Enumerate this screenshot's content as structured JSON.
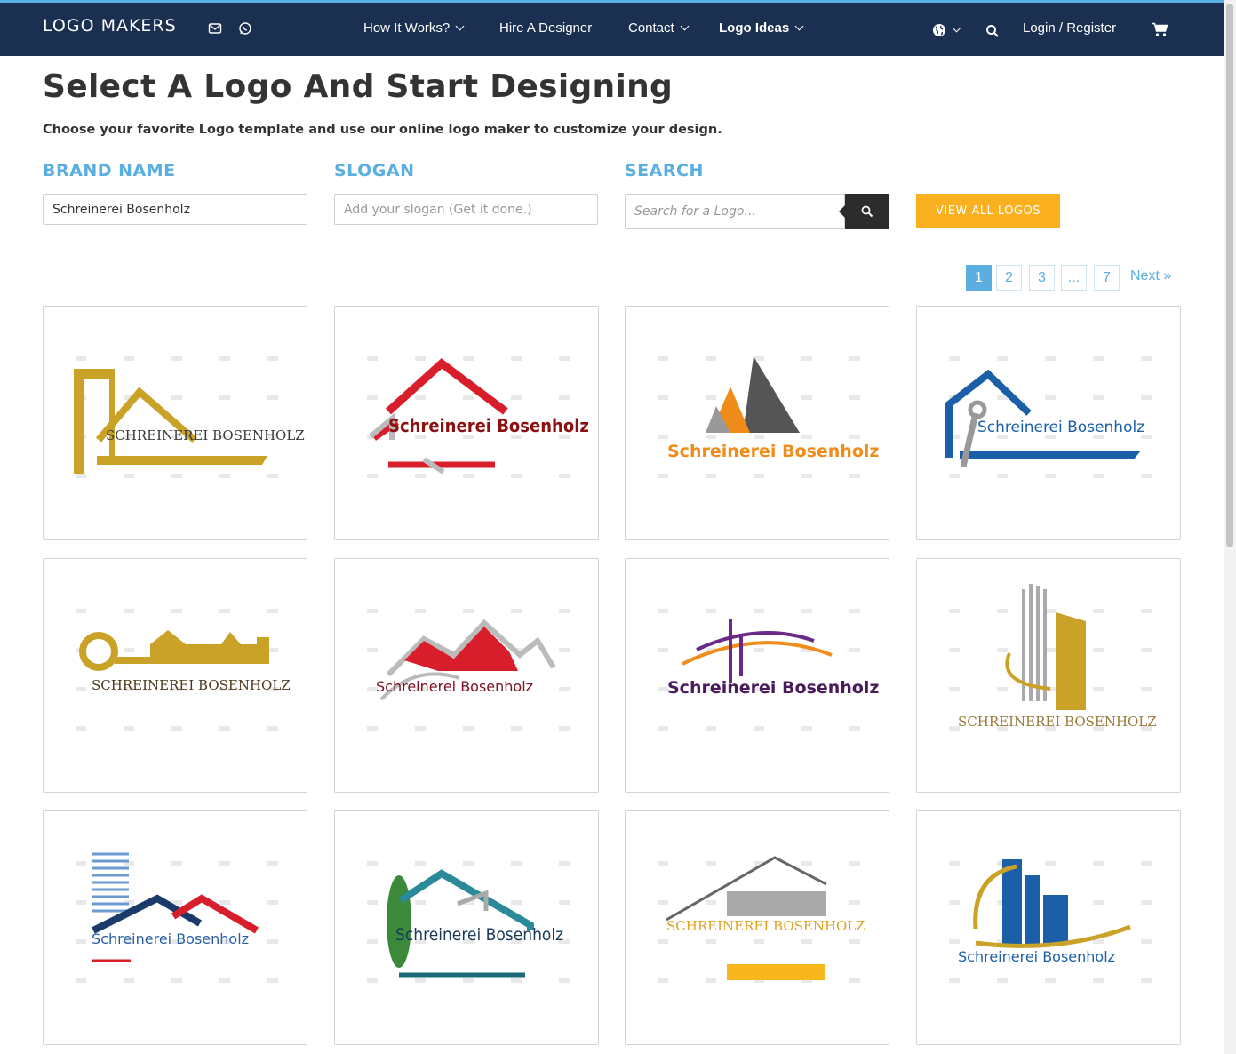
{
  "header": {
    "logo": "LOGO MAKERS",
    "nav": [
      {
        "label": "How It Works?",
        "dropdown": true
      },
      {
        "label": "Hire A Designer",
        "dropdown": false
      },
      {
        "label": "Contact",
        "dropdown": true
      },
      {
        "label": "Logo Ideas",
        "dropdown": true
      }
    ],
    "login": "Login / Register",
    "icons": [
      "mail-icon",
      "whatsapp-icon",
      "globe-icon",
      "search-icon",
      "cart-icon"
    ]
  },
  "page": {
    "title": "Select A Logo And Start Designing",
    "subtitle": "Choose your favorite Logo template and use our online logo maker to customize your design."
  },
  "form": {
    "brand_label": "BRAND NAME",
    "brand_value": "Schreinerei Bosenholz",
    "slogan_label": "SLOGAN",
    "slogan_placeholder": "Add your slogan (Get it done.)",
    "search_label": "SEARCH",
    "search_placeholder": "Search for a Logo...",
    "view_all": "VIEW ALL LOGOS"
  },
  "pagination": {
    "pages": [
      "1",
      "2",
      "3",
      "...",
      "7"
    ],
    "active": "1",
    "next": "Next »"
  },
  "logos": [
    {
      "text": "SCHREINEREI BOSENHOLZ",
      "color": "#3a3a3a"
    },
    {
      "text": "Schreinerei Bosenholz",
      "color": "#8c1010"
    },
    {
      "text": "Schreinerei Bosenholz",
      "color": "#f08c1a"
    },
    {
      "text": "Schreinerei Bosenholz",
      "color": "#1a5fa8"
    },
    {
      "text": "SCHREINEREI BOSENHOLZ",
      "color": "#4a3a1a"
    },
    {
      "text": "Schreinerei Bosenholz",
      "color": "#7a1020"
    },
    {
      "text": "Schreinerei Bosenholz",
      "color": "#4a1a5a"
    },
    {
      "text": "SCHREINEREI BOSENHOLZ",
      "color": "#9a7a3a"
    },
    {
      "text": "Schreinerei Bosenholz",
      "color": "#2a5fa8"
    },
    {
      "text": "Schreinerei Bosenholz",
      "color": "#1a3a5a"
    },
    {
      "text": "SCHREINEREI BOSENHOLZ",
      "color": "#e0a020"
    },
    {
      "text": "Schreinerei Bosenholz",
      "color": "#1a5fa8"
    }
  ]
}
